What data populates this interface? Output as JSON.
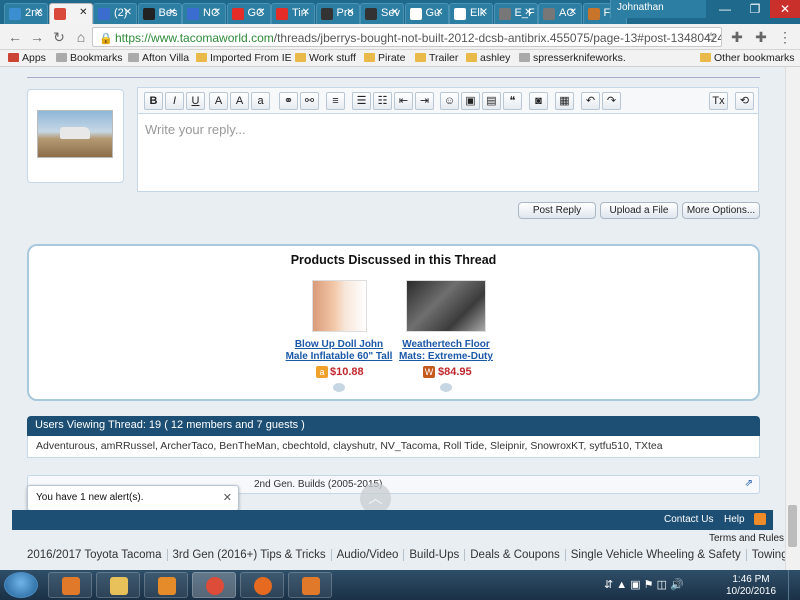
{
  "browser": {
    "tabs": [
      {
        "label": "2nc",
        "color": "#3b8fd0"
      },
      {
        "label": "",
        "color": "#d94a3c",
        "active": true
      },
      {
        "label": "(2)",
        "color": "#3b6cd0"
      },
      {
        "label": "Bes",
        "color": "#222222"
      },
      {
        "label": "NC",
        "color": "#3b6cd0"
      },
      {
        "label": "GC",
        "color": "#e52d27"
      },
      {
        "label": "Tin",
        "color": "#e52d27"
      },
      {
        "label": "Pro",
        "color": "#333333"
      },
      {
        "label": "Sev",
        "color": "#333333"
      },
      {
        "label": "Gu",
        "color": "#ffffff"
      },
      {
        "label": "Elk",
        "color": "#ffffff"
      },
      {
        "label": "E_F",
        "color": "#777777"
      },
      {
        "label": "AC",
        "color": "#777777"
      },
      {
        "label": "Fox",
        "color": "#c8742a"
      }
    ],
    "profile_name": "Johnathan",
    "url_scheme": "https://",
    "url_host": "www.tacomaworld.com",
    "url_path": "/threads/jberrys-bought-not-built-2012-dcsb-antibrix.455075/page-13#post-13480424",
    "bookmarks": [
      {
        "label": "Apps",
        "type": "apps"
      },
      {
        "label": "Bookmarks",
        "type": "page"
      },
      {
        "label": "Afton Villa",
        "type": "page"
      },
      {
        "label": "Imported From IE",
        "type": "folder"
      },
      {
        "label": "Work stuff",
        "type": "folder"
      },
      {
        "label": "Pirate",
        "type": "folder"
      },
      {
        "label": "Trailer",
        "type": "folder"
      },
      {
        "label": "ashley",
        "type": "folder"
      },
      {
        "label": "spresserknifeworks.",
        "type": "page"
      }
    ],
    "other_bookmarks": "Other bookmarks"
  },
  "editor": {
    "placeholder": "Write your reply...",
    "toolbar_icons": [
      "bold-icon",
      "italic-icon",
      "underline-icon",
      "font-color-icon",
      "font-size-icon",
      "font-family-icon",
      "link-icon",
      "unlink-icon",
      "align-icon",
      "bullet-list-icon",
      "numbered-list-icon",
      "outdent-icon",
      "indent-icon",
      "smilie-icon",
      "image-icon",
      "media-icon",
      "quote-icon",
      "camera-icon",
      "save-draft-icon",
      "undo-icon",
      "redo-icon",
      "remove-format-icon",
      "toggle-bbcode-icon"
    ],
    "buttons": {
      "post_reply": "Post Reply",
      "upload": "Upload a File",
      "more": "More Options..."
    }
  },
  "products": {
    "title": "Products Discussed in this Thread",
    "items": [
      {
        "name_line1": "Blow Up Doll John",
        "name_line2": "Male Inflatable 60\" Tall",
        "price": "$10.88",
        "store": "amazon",
        "store_color": "#f0a12b"
      },
      {
        "name_line1": "Weathertech Floor",
        "name_line2": "Mats: Extreme-Duty",
        "price": "$84.95",
        "store": "weathertech",
        "store_color": "#c45a1e"
      }
    ]
  },
  "viewers": {
    "heading": "Users Viewing Thread: 19 ( 12 members and 7 guests )",
    "list": "Adventurous, amRRussel, ArcherTaco, BenTheMan, cbechtold, clayshutr, NV_Tacoma, Roll Tide, Sleipnir, SnowroxKT, sytfu510, TXtea"
  },
  "breadcrumb": {
    "current": "2nd Gen. Builds (2005-2015)"
  },
  "alert": {
    "text": "You have 1 new alert(s)."
  },
  "footer": {
    "contact": "Contact Us",
    "help": "Help",
    "terms": "Terms and Rules",
    "categories": [
      "2016/2017 Toyota Tacoma",
      "3rd Gen (2016+) Tips & Tricks",
      "Audio/Video",
      "Build-Ups",
      "Deals & Coupons",
      "Single Vehicle Wheeling & Safety",
      "Towing"
    ]
  },
  "taskbar": {
    "time": "1:46 PM",
    "date": "10/20/2016",
    "apps": [
      {
        "name": "rss-app-icon",
        "color": "#e07a2a"
      },
      {
        "name": "file-explorer-icon",
        "color": "#e8c15a"
      },
      {
        "name": "media-player-icon",
        "color": "#e58b2a"
      },
      {
        "name": "chrome-icon",
        "color": "#dd4b39"
      },
      {
        "name": "firefox-icon",
        "color": "#e66a1f"
      },
      {
        "name": "rss-app-2-icon",
        "color": "#e07a2a"
      }
    ]
  }
}
